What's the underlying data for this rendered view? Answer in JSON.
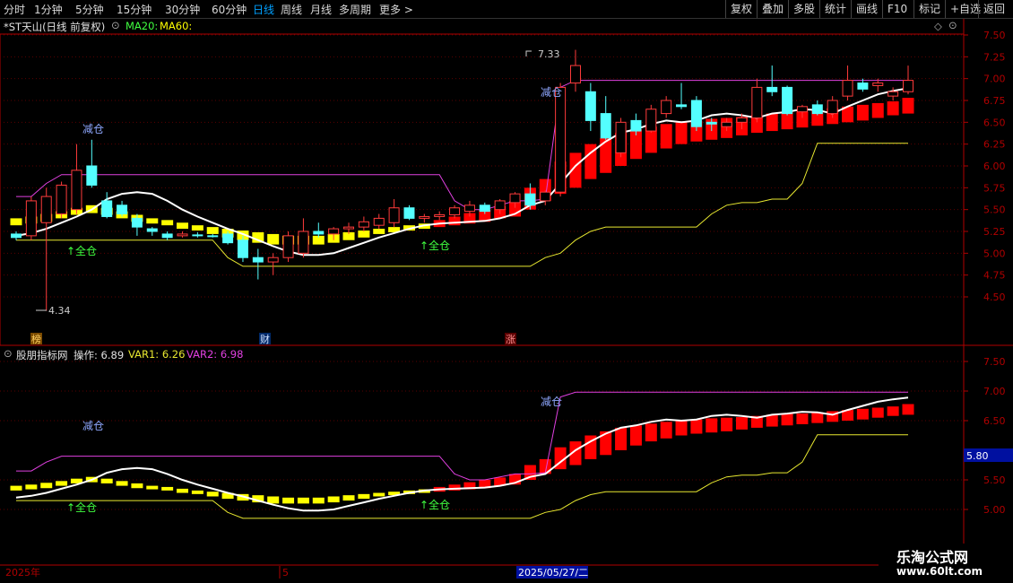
{
  "toolbar": {
    "periods": [
      "分时",
      "1分钟",
      "5分钟",
      "15分钟",
      "30分钟",
      "60分钟",
      "日线",
      "周线",
      "月线",
      "多周期",
      "更多 >"
    ],
    "active_period": "日线",
    "right_buttons": [
      "复权",
      "叠加",
      "多股",
      "统计",
      "画线",
      "F10",
      "标记",
      "+自选",
      "返回"
    ]
  },
  "main_panel": {
    "title": "*ST天山(日线 前复权)",
    "ma20_label": "MA20:",
    "ma60_label": "MA60:",
    "y_ticks": [
      "7.50",
      "7.25",
      "7.00",
      "6.75",
      "6.50",
      "6.25",
      "6.00",
      "5.75",
      "5.50",
      "5.25",
      "5.00",
      "4.75",
      "4.50"
    ],
    "high_label": "7.33",
    "low_label": "4.34",
    "reduce_label": "减仓",
    "full_label": "↑全仓",
    "event_markers": [
      "榜",
      "财",
      "涨"
    ]
  },
  "indicator_panel": {
    "title": "股朋指标网",
    "op_label": "操作: 6.89",
    "var1_label": "VAR1: 6.26",
    "var2_label": "VAR2: 6.98",
    "y_ticks": [
      "7.50",
      "7.00",
      "6.50",
      "5.50",
      "5.00"
    ],
    "cursor_value": "5.80",
    "reduce_label": "减仓",
    "full_label": "↑全仓"
  },
  "time_axis": {
    "labels": [
      "2025年",
      "5"
    ],
    "cursor_date": "2025/05/27/二"
  },
  "watermark": {
    "line1": "乐淘公式网",
    "line2": "www.60lt.com"
  },
  "colors": {
    "up": "#ff3b3b",
    "down": "#54ffff",
    "band_red": "#ff0000",
    "band_yellow": "#ffff00",
    "white_line": "#ffffff",
    "magenta_line": "#e040e0",
    "yellow_line": "#e8e830",
    "axis_red": "#b00000"
  },
  "chart_data": {
    "type": "candlestick",
    "x": [
      1,
      2,
      3,
      4,
      5,
      6,
      7,
      8,
      9,
      10,
      11,
      12,
      13,
      14,
      15,
      16,
      17,
      18,
      19,
      20,
      21,
      22,
      23,
      24,
      25,
      26,
      27,
      28,
      29,
      30,
      31,
      32,
      33,
      34,
      35,
      36,
      37,
      38,
      39,
      40,
      41,
      42,
      43,
      44,
      45,
      46,
      47,
      48,
      49,
      50,
      51,
      52,
      53,
      54,
      55,
      56,
      57,
      58,
      59,
      60
    ],
    "candles": [
      {
        "o": 5.22,
        "h": 5.25,
        "l": 5.15,
        "c": 5.18
      },
      {
        "o": 5.2,
        "h": 5.65,
        "l": 5.15,
        "c": 5.6
      },
      {
        "o": 5.35,
        "h": 5.75,
        "l": 4.34,
        "c": 5.65
      },
      {
        "o": 5.45,
        "h": 5.82,
        "l": 5.4,
        "c": 5.78
      },
      {
        "o": 5.5,
        "h": 6.25,
        "l": 5.45,
        "c": 5.95
      },
      {
        "o": 6.0,
        "h": 6.3,
        "l": 5.75,
        "c": 5.78
      },
      {
        "o": 5.6,
        "h": 5.7,
        "l": 5.4,
        "c": 5.42
      },
      {
        "o": 5.55,
        "h": 5.6,
        "l": 5.42,
        "c": 5.45
      },
      {
        "o": 5.4,
        "h": 5.45,
        "l": 5.2,
        "c": 5.3
      },
      {
        "o": 5.28,
        "h": 5.3,
        "l": 5.2,
        "c": 5.25
      },
      {
        "o": 5.22,
        "h": 5.25,
        "l": 5.15,
        "c": 5.18
      },
      {
        "o": 5.2,
        "h": 5.25,
        "l": 5.18,
        "c": 5.22
      },
      {
        "o": 5.21,
        "h": 5.24,
        "l": 5.18,
        "c": 5.2
      },
      {
        "o": 5.2,
        "h": 5.22,
        "l": 5.18,
        "c": 5.19
      },
      {
        "o": 5.22,
        "h": 5.25,
        "l": 5.1,
        "c": 5.12
      },
      {
        "o": 5.15,
        "h": 5.2,
        "l": 4.9,
        "c": 4.95
      },
      {
        "o": 4.95,
        "h": 5.05,
        "l": 4.7,
        "c": 4.9
      },
      {
        "o": 4.9,
        "h": 5.0,
        "l": 4.75,
        "c": 4.95
      },
      {
        "o": 4.95,
        "h": 5.25,
        "l": 4.9,
        "c": 5.2
      },
      {
        "o": 5.0,
        "h": 5.4,
        "l": 4.95,
        "c": 5.25
      },
      {
        "o": 5.25,
        "h": 5.35,
        "l": 5.18,
        "c": 5.22
      },
      {
        "o": 5.22,
        "h": 5.3,
        "l": 5.15,
        "c": 5.28
      },
      {
        "o": 5.28,
        "h": 5.35,
        "l": 5.22,
        "c": 5.3
      },
      {
        "o": 5.3,
        "h": 5.42,
        "l": 5.25,
        "c": 5.36
      },
      {
        "o": 5.32,
        "h": 5.45,
        "l": 5.28,
        "c": 5.4
      },
      {
        "o": 5.35,
        "h": 5.62,
        "l": 5.3,
        "c": 5.52
      },
      {
        "o": 5.52,
        "h": 5.55,
        "l": 5.38,
        "c": 5.4
      },
      {
        "o": 5.4,
        "h": 5.45,
        "l": 5.35,
        "c": 5.42
      },
      {
        "o": 5.42,
        "h": 5.48,
        "l": 5.38,
        "c": 5.44
      },
      {
        "o": 5.44,
        "h": 5.55,
        "l": 5.4,
        "c": 5.52
      },
      {
        "o": 5.48,
        "h": 5.6,
        "l": 5.42,
        "c": 5.55
      },
      {
        "o": 5.55,
        "h": 5.58,
        "l": 5.45,
        "c": 5.48
      },
      {
        "o": 5.5,
        "h": 5.62,
        "l": 5.45,
        "c": 5.6
      },
      {
        "o": 5.58,
        "h": 5.7,
        "l": 5.52,
        "c": 5.68
      },
      {
        "o": 5.68,
        "h": 5.8,
        "l": 5.5,
        "c": 5.55
      },
      {
        "o": 5.6,
        "h": 5.72,
        "l": 5.55,
        "c": 5.7
      },
      {
        "o": 5.7,
        "h": 6.95,
        "l": 5.65,
        "c": 6.9
      },
      {
        "o": 6.95,
        "h": 7.33,
        "l": 6.85,
        "c": 7.15
      },
      {
        "o": 6.85,
        "h": 6.95,
        "l": 6.4,
        "c": 6.52
      },
      {
        "o": 6.6,
        "h": 6.8,
        "l": 6.3,
        "c": 6.32
      },
      {
        "o": 6.15,
        "h": 6.55,
        "l": 6.1,
        "c": 6.5
      },
      {
        "o": 6.52,
        "h": 6.6,
        "l": 6.35,
        "c": 6.4
      },
      {
        "o": 6.4,
        "h": 6.7,
        "l": 6.38,
        "c": 6.65
      },
      {
        "o": 6.6,
        "h": 6.8,
        "l": 6.55,
        "c": 6.75
      },
      {
        "o": 6.7,
        "h": 6.95,
        "l": 6.65,
        "c": 6.68
      },
      {
        "o": 6.75,
        "h": 6.8,
        "l": 6.4,
        "c": 6.45
      },
      {
        "o": 6.5,
        "h": 6.55,
        "l": 6.4,
        "c": 6.48
      },
      {
        "o": 6.45,
        "h": 6.55,
        "l": 6.4,
        "c": 6.5
      },
      {
        "o": 6.5,
        "h": 6.6,
        "l": 6.42,
        "c": 6.55
      },
      {
        "o": 6.55,
        "h": 7.0,
        "l": 6.5,
        "c": 6.9
      },
      {
        "o": 6.9,
        "h": 7.15,
        "l": 6.8,
        "c": 6.85
      },
      {
        "o": 6.9,
        "h": 6.92,
        "l": 6.58,
        "c": 6.6
      },
      {
        "o": 6.62,
        "h": 6.7,
        "l": 6.55,
        "c": 6.68
      },
      {
        "o": 6.7,
        "h": 6.75,
        "l": 6.58,
        "c": 6.6
      },
      {
        "o": 6.6,
        "h": 6.8,
        "l": 6.55,
        "c": 6.75
      },
      {
        "o": 6.8,
        "h": 7.15,
        "l": 6.75,
        "c": 6.98
      },
      {
        "o": 6.95,
        "h": 7.0,
        "l": 6.85,
        "c": 6.88
      },
      {
        "o": 6.92,
        "h": 7.0,
        "l": 6.85,
        "c": 6.95
      },
      {
        "o": 6.8,
        "h": 6.9,
        "l": 6.75,
        "c": 6.85
      },
      {
        "o": 6.85,
        "h": 7.15,
        "l": 6.82,
        "c": 6.98
      }
    ],
    "ma20": [
      5.2,
      5.23,
      5.28,
      5.35,
      5.42,
      5.5,
      5.62,
      5.68,
      5.7,
      5.68,
      5.6,
      5.5,
      5.42,
      5.35,
      5.28,
      5.22,
      5.15,
      5.08,
      5.02,
      4.98,
      4.98,
      5.0,
      5.06,
      5.12,
      5.18,
      5.23,
      5.28,
      5.32,
      5.34,
      5.35,
      5.36,
      5.37,
      5.4,
      5.45,
      5.55,
      5.6,
      5.8,
      6.0,
      6.15,
      6.28,
      6.38,
      6.42,
      6.48,
      6.52,
      6.5,
      6.52,
      6.58,
      6.6,
      6.58,
      6.55,
      6.6,
      6.62,
      6.65,
      6.64,
      6.6,
      6.68,
      6.75,
      6.82,
      6.86,
      6.89
    ],
    "var2": [
      5.65,
      5.65,
      5.8,
      5.9,
      5.9,
      5.9,
      5.9,
      5.9,
      5.9,
      5.9,
      5.9,
      5.9,
      5.9,
      5.9,
      5.9,
      5.9,
      5.9,
      5.9,
      5.9,
      5.9,
      5.9,
      5.9,
      5.9,
      5.9,
      5.9,
      5.9,
      5.9,
      5.9,
      5.9,
      5.6,
      5.5,
      5.5,
      5.55,
      5.6,
      5.6,
      5.62,
      6.9,
      6.98,
      6.98,
      6.98,
      6.98,
      6.98,
      6.98,
      6.98,
      6.98,
      6.98,
      6.98,
      6.98,
      6.98,
      6.98,
      6.98,
      6.98,
      6.98,
      6.98,
      6.98,
      6.98,
      6.98,
      6.98,
      6.98,
      6.98
    ],
    "var1": [
      5.15,
      5.15,
      5.15,
      5.15,
      5.15,
      5.15,
      5.15,
      5.15,
      5.15,
      5.15,
      5.15,
      5.15,
      5.15,
      5.15,
      4.95,
      4.85,
      4.85,
      4.85,
      4.85,
      4.85,
      4.85,
      4.85,
      4.85,
      4.85,
      4.85,
      4.85,
      4.85,
      4.85,
      4.85,
      4.85,
      4.85,
      4.85,
      4.85,
      4.85,
      4.85,
      4.95,
      5.0,
      5.15,
      5.25,
      5.3,
      5.3,
      5.3,
      5.3,
      5.3,
      5.3,
      5.3,
      5.45,
      5.55,
      5.58,
      5.58,
      5.62,
      5.62,
      5.8,
      6.26,
      6.26,
      6.26,
      6.26,
      6.26,
      6.26,
      6.26
    ],
    "band_top": [
      5.4,
      5.42,
      5.45,
      5.48,
      5.52,
      5.55,
      5.52,
      5.48,
      5.44,
      5.4,
      5.38,
      5.35,
      5.32,
      5.3,
      5.28,
      5.26,
      5.24,
      5.22,
      5.2,
      5.2,
      5.2,
      5.22,
      5.24,
      5.26,
      5.28,
      5.3,
      5.32,
      5.34,
      5.38,
      5.42,
      5.46,
      5.5,
      5.54,
      5.6,
      5.75,
      5.85,
      6.05,
      6.15,
      6.25,
      6.32,
      6.38,
      6.42,
      6.45,
      6.48,
      6.5,
      6.52,
      6.54,
      6.55,
      6.56,
      6.58,
      6.6,
      6.62,
      6.62,
      6.64,
      6.66,
      6.68,
      6.7,
      6.72,
      6.74,
      6.78
    ],
    "band_bottom": [
      5.32,
      5.34,
      5.36,
      5.4,
      5.44,
      5.46,
      5.44,
      5.4,
      5.36,
      5.34,
      5.32,
      5.28,
      5.26,
      5.22,
      5.18,
      5.15,
      5.12,
      5.1,
      5.1,
      5.1,
      5.1,
      5.12,
      5.15,
      5.18,
      5.22,
      5.24,
      5.26,
      5.28,
      5.3,
      5.32,
      5.34,
      5.36,
      5.4,
      5.42,
      5.5,
      5.6,
      5.68,
      5.75,
      5.85,
      5.92,
      6.0,
      6.08,
      6.15,
      6.2,
      6.25,
      6.28,
      6.3,
      6.32,
      6.35,
      6.38,
      6.4,
      6.42,
      6.44,
      6.46,
      6.48,
      6.5,
      6.52,
      6.55,
      6.58,
      6.6
    ],
    "band_color_switch_index": 28
  }
}
